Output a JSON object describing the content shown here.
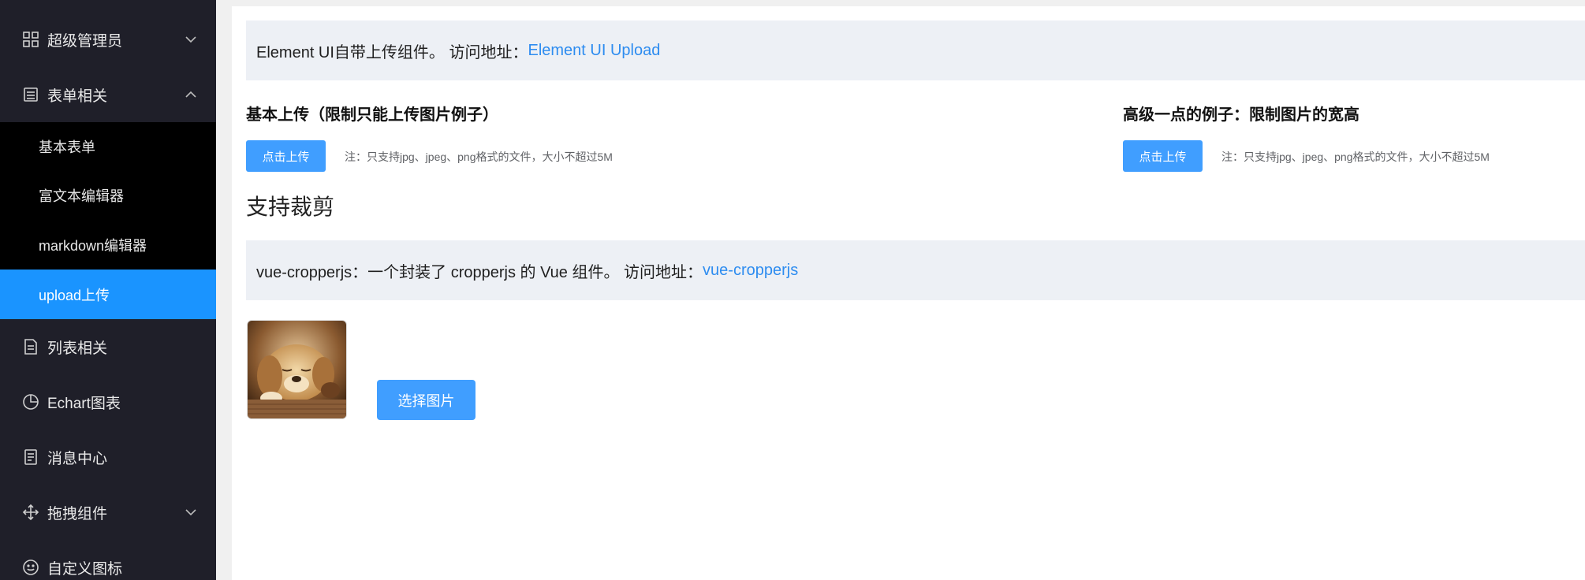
{
  "sidebar": {
    "items": [
      {
        "label": "超级管理员",
        "icon": "grid-icon",
        "arrow": "chevron-down-icon"
      },
      {
        "label": "表单相关",
        "icon": "form-icon",
        "arrow": "chevron-up-icon"
      },
      {
        "label": "列表相关",
        "icon": "list-icon"
      },
      {
        "label": "Echart图表",
        "icon": "pie-chart-icon"
      },
      {
        "label": "消息中心",
        "icon": "message-icon"
      },
      {
        "label": "拖拽组件",
        "icon": "drag-icon",
        "arrow": "chevron-down-icon"
      },
      {
        "label": "自定义图标",
        "icon": "smile-icon"
      }
    ],
    "submenu": [
      {
        "label": "基本表单"
      },
      {
        "label": "富文本编辑器"
      },
      {
        "label": "markdown编辑器"
      },
      {
        "label": "upload上传",
        "active": true
      }
    ]
  },
  "main": {
    "notice1": {
      "text": "Element UI自带上传组件。 访问地址：",
      "link": "Element UI Upload"
    },
    "basic_upload": {
      "heading": "基本上传（限制只能上传图片例子）",
      "button": "点击上传",
      "tip": "注：只支持jpg、jpeg、png格式的文件，大小不超过5M"
    },
    "advanced_upload": {
      "heading": "高级一点的例子：限制图片的宽高",
      "button": "点击上传",
      "tip": "注：只支持jpg、jpeg、png格式的文件，大小不超过5M"
    },
    "crop_title": "支持裁剪",
    "notice2": {
      "text": "vue-cropperjs：一个封装了 cropperjs 的 Vue 组件。 访问地址：",
      "link": "vue-cropperjs"
    },
    "choose_button": "选择图片"
  },
  "colors": {
    "sidebar_bg": "#1f1f29",
    "submenu_bg": "#000000",
    "active": "#1a94ff",
    "primary": "#409eff",
    "link": "#2d8cf0",
    "notice_bg": "#edf0f5"
  }
}
